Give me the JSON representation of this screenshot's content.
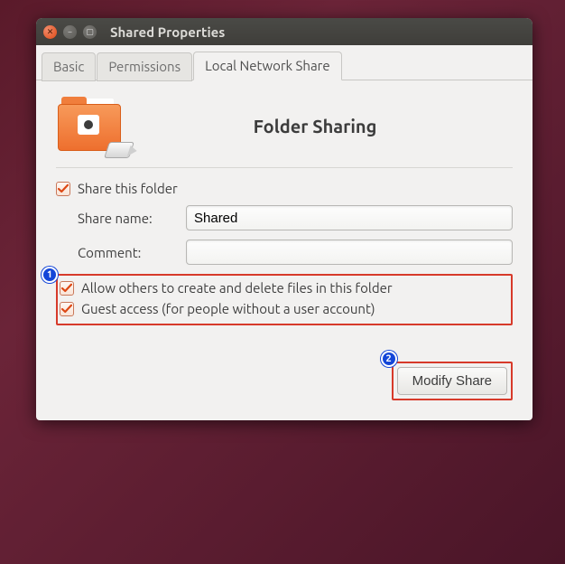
{
  "window": {
    "title": "Shared Properties"
  },
  "tabs": {
    "basic": "Basic",
    "permissions": "Permissions",
    "local_network_share": "Local Network Share"
  },
  "panel": {
    "heading": "Folder Sharing",
    "share_this_folder_label": "Share this folder",
    "share_name_label": "Share name:",
    "share_name_value": "Shared",
    "comment_label": "Comment:",
    "comment_value": "",
    "allow_others_label": "Allow others to create and delete files in this folder",
    "guest_access_label": "Guest access (for people without a user account)"
  },
  "actions": {
    "modify_share": "Modify Share"
  },
  "annotations": {
    "one": "1",
    "two": "2"
  }
}
